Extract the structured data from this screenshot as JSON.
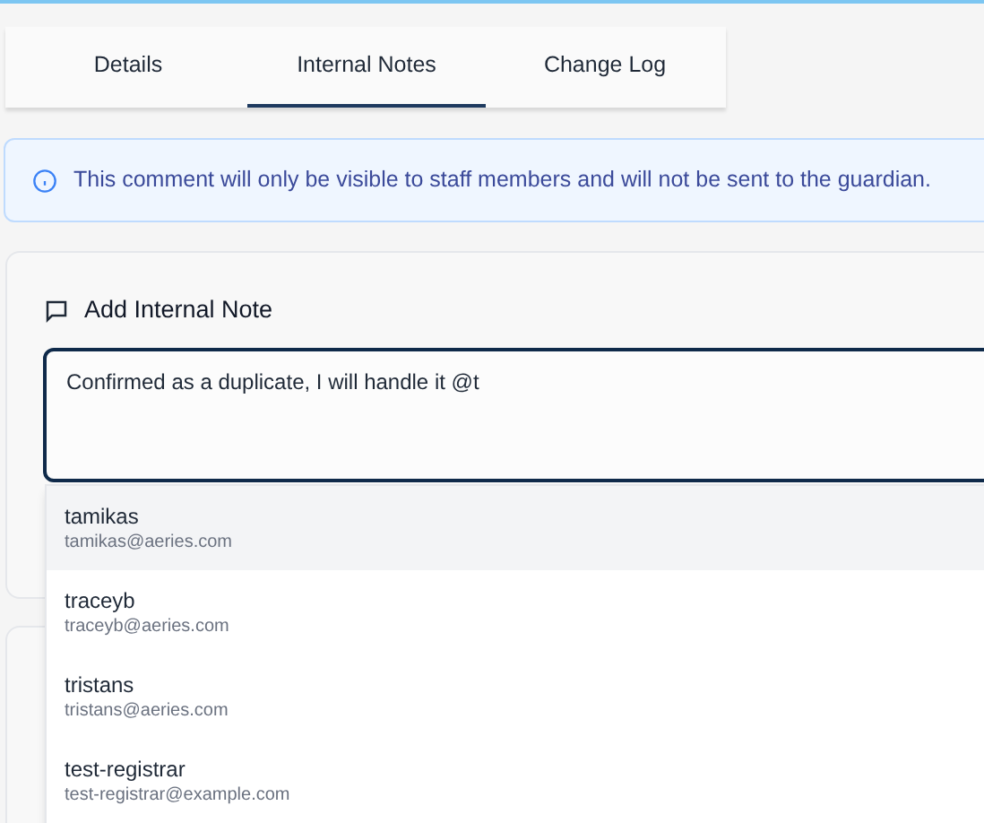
{
  "tabs": [
    {
      "label": "Details",
      "selected": false
    },
    {
      "label": "Internal Notes",
      "selected": true
    },
    {
      "label": "Change Log",
      "selected": false
    }
  ],
  "notice": {
    "text": "This comment will only be visible to staff members and will not be sent to the guardian."
  },
  "note_card": {
    "title": "Add Internal Note",
    "value": "Confirmed as a duplicate, I will handle it @t"
  },
  "mention_suggestions": [
    {
      "username": "tamikas",
      "email": "tamikas@aeries.com",
      "selected": true
    },
    {
      "username": "traceyb",
      "email": "traceyb@aeries.com",
      "selected": false
    },
    {
      "username": "tristans",
      "email": "tristans@aeries.com",
      "selected": false
    },
    {
      "username": "test-registrar",
      "email": "test-registrar@example.com",
      "selected": false
    }
  ]
}
